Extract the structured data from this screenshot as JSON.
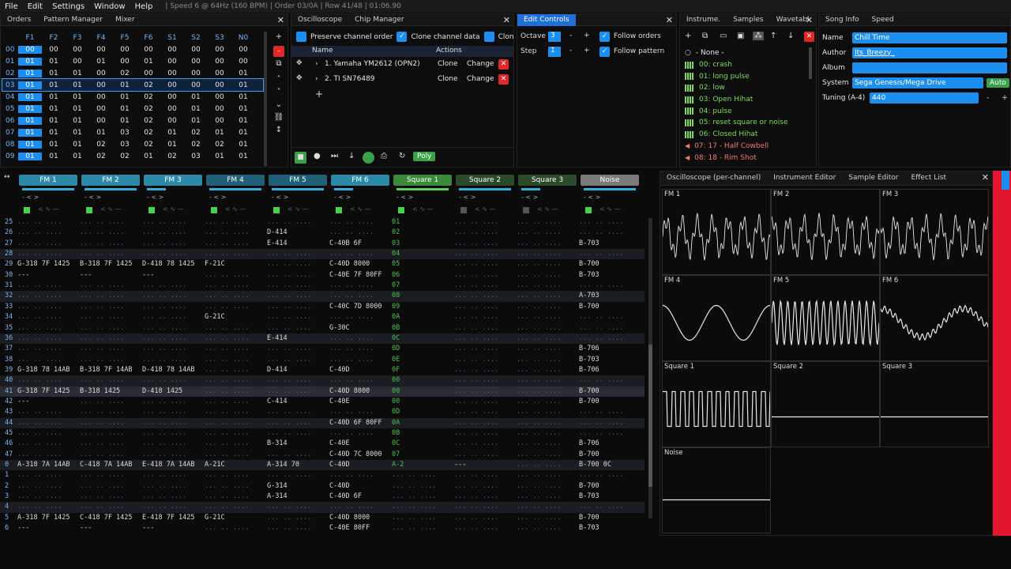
{
  "menubar": {
    "items": [
      "File",
      "Edit",
      "Settings",
      "Window",
      "Help"
    ],
    "status": "| Speed 6 @ 64Hz (160 BPM) | Order 03/0A | Row 41/48 | 01:06.90"
  },
  "orders": {
    "tabs": [
      "Orders",
      "Pattern Manager",
      "Mixer"
    ],
    "columns": [
      "F1",
      "F2",
      "F3",
      "F4",
      "F5",
      "F6",
      "S1",
      "S2",
      "S3",
      "N0"
    ],
    "rows": [
      {
        "idx": "00",
        "vals": [
          "00",
          "00",
          "00",
          "00",
          "00",
          "00",
          "00",
          "00",
          "00",
          "00"
        ]
      },
      {
        "idx": "01",
        "vals": [
          "01",
          "01",
          "00",
          "01",
          "00",
          "01",
          "00",
          "00",
          "00",
          "00"
        ]
      },
      {
        "idx": "02",
        "vals": [
          "01",
          "01",
          "01",
          "00",
          "02",
          "00",
          "00",
          "00",
          "00",
          "01"
        ]
      },
      {
        "idx": "03",
        "vals": [
          "01",
          "01",
          "01",
          "00",
          "01",
          "02",
          "00",
          "00",
          "00",
          "01"
        ]
      },
      {
        "idx": "04",
        "vals": [
          "01",
          "01",
          "01",
          "00",
          "01",
          "02",
          "00",
          "01",
          "00",
          "01"
        ]
      },
      {
        "idx": "05",
        "vals": [
          "01",
          "01",
          "01",
          "00",
          "01",
          "02",
          "00",
          "01",
          "00",
          "01"
        ]
      },
      {
        "idx": "06",
        "vals": [
          "01",
          "01",
          "01",
          "00",
          "01",
          "02",
          "00",
          "01",
          "00",
          "01"
        ]
      },
      {
        "idx": "07",
        "vals": [
          "01",
          "01",
          "01",
          "01",
          "03",
          "02",
          "01",
          "02",
          "01",
          "01"
        ]
      },
      {
        "idx": "08",
        "vals": [
          "01",
          "01",
          "01",
          "02",
          "03",
          "02",
          "01",
          "02",
          "02",
          "01"
        ]
      },
      {
        "idx": "09",
        "vals": [
          "01",
          "01",
          "01",
          "02",
          "02",
          "01",
          "02",
          "03",
          "01",
          "01"
        ]
      }
    ]
  },
  "chip": {
    "tabs": [
      "Oscilloscope",
      "Chip Manager"
    ],
    "options": [
      "Preserve channel order",
      "Clone channel data",
      "Clone"
    ],
    "col_name": "Name",
    "col_actions": "Actions",
    "chips": [
      "1. Yamaha YM2612 (OPN2)",
      "2. TI SN76489"
    ],
    "clone": "Clone",
    "change": "Change",
    "poly": "Poly"
  },
  "edit": {
    "tab": "Edit Controls",
    "octave_label": "Octave",
    "octave_value": "3",
    "step_label": "Step",
    "step_value": "1",
    "follow_orders": "Follow orders",
    "follow_pattern": "Follow pattern"
  },
  "instruments": {
    "tabs": [
      "Instrume.",
      "Samples",
      "Wavetabl."
    ],
    "items": [
      {
        "label": "- None -",
        "color": "#e6e6e6"
      },
      {
        "label": "00: crash",
        "color": "#7cdc5a"
      },
      {
        "label": "01: long pulse",
        "color": "#7cdc5a"
      },
      {
        "label": "02: low",
        "color": "#7cdc5a"
      },
      {
        "label": "03: Open Hihat",
        "color": "#7cdc5a"
      },
      {
        "label": "04: pulse",
        "color": "#7cdc5a"
      },
      {
        "label": "05: reset square or noise",
        "color": "#7cdc5a"
      },
      {
        "label": "06: Closed Hihat",
        "color": "#7cdc5a"
      },
      {
        "label": "07: 17 - Half Cowbell",
        "color": "#f07a7a"
      },
      {
        "label": "08: 18 - Rim Shot",
        "color": "#f07a7a"
      }
    ]
  },
  "song": {
    "tabs": [
      "Song Info",
      "Speed"
    ],
    "name_label": "Name",
    "name": "Chill Time",
    "author_label": "Author",
    "author": "Its_Breezy_",
    "album_label": "Album",
    "album": "",
    "system_label": "System",
    "system": "Sega Genesis/Mega Drive",
    "auto": "Auto",
    "tuning_label": "Tuning (A-4)",
    "tuning": "440"
  },
  "pattern": {
    "channels": [
      {
        "name": "FM 1",
        "color": "#2a8aa8"
      },
      {
        "name": "FM 2",
        "color": "#2a8aa8"
      },
      {
        "name": "FM 3",
        "color": "#2a8aa8"
      },
      {
        "name": "FM 4",
        "color": "#1f5f7a"
      },
      {
        "name": "FM 5",
        "color": "#1f5f7a"
      },
      {
        "name": "FM 6",
        "color": "#2a8aa8"
      },
      {
        "name": "Square 1",
        "color": "#3a8a3a"
      },
      {
        "name": "Square 2",
        "color": "#2a4a2a"
      },
      {
        "name": "Square 3",
        "color": "#2a4a2a"
      },
      {
        "name": "Noise",
        "color": "#7a7a7a"
      }
    ],
    "rows": [
      {
        "n": "25",
        "c": [
          "",
          "",
          "",
          "",
          "",
          "",
          "01",
          "",
          "",
          ""
        ]
      },
      {
        "n": "26",
        "c": [
          "",
          "",
          "",
          "",
          "D-414",
          "",
          "02",
          "",
          "",
          ""
        ]
      },
      {
        "n": "27",
        "c": [
          "",
          "",
          "",
          "",
          "E-414",
          "C-40B 6F",
          "03",
          "",
          "",
          "B-703"
        ]
      },
      {
        "n": "28",
        "c": [
          "",
          "",
          "",
          "",
          "",
          "",
          "04",
          "",
          "",
          ""
        ]
      },
      {
        "n": "29",
        "c": [
          "G-318 7F 1425",
          "B-318 7F 1425",
          "D-418 78 1425",
          "F-21C",
          "",
          "C-40D 8000",
          "05",
          "",
          "",
          "B-700"
        ]
      },
      {
        "n": "30",
        "c": [
          "---",
          "---",
          "---",
          "",
          "",
          "C-40E 7F 80FF",
          "06",
          "",
          "",
          "B-703"
        ]
      },
      {
        "n": "31",
        "c": [
          "",
          "",
          "",
          "",
          "",
          "",
          "07",
          "",
          "",
          ""
        ]
      },
      {
        "n": "32",
        "c": [
          "",
          "",
          "",
          "",
          "",
          "",
          "08",
          "",
          "",
          "A-703"
        ]
      },
      {
        "n": "33",
        "c": [
          "",
          "",
          "",
          "",
          "",
          "C-40C 7D 8000",
          "09",
          "",
          "",
          "B-700"
        ]
      },
      {
        "n": "34",
        "c": [
          "",
          "",
          "",
          "G-21C",
          "",
          "",
          "0A",
          "",
          "",
          ""
        ]
      },
      {
        "n": "35",
        "c": [
          "",
          "",
          "",
          "",
          "",
          "G-30C",
          "0B",
          "",
          "",
          ""
        ]
      },
      {
        "n": "36",
        "c": [
          "",
          "",
          "",
          "",
          "E-414",
          "",
          "0C",
          "",
          "",
          ""
        ]
      },
      {
        "n": "37",
        "c": [
          "",
          "",
          "",
          "",
          "",
          "",
          "0D",
          "",
          "",
          "B-706"
        ]
      },
      {
        "n": "38",
        "c": [
          "",
          "",
          "",
          "",
          "",
          "",
          "0E",
          "",
          "",
          "B-703"
        ]
      },
      {
        "n": "39",
        "c": [
          "G-318 78 14AB",
          "B-318 7F 14AB",
          "D-418 78 14AB",
          "",
          "D-414",
          "C-40D",
          "0F",
          "",
          "",
          "B-706"
        ]
      },
      {
        "n": "40",
        "c": [
          "",
          "",
          "",
          "",
          "",
          "",
          "00",
          "",
          "",
          ""
        ]
      },
      {
        "n": "41",
        "c": [
          "G-318 7F 1425",
          "B-318 1425",
          "D-418 1425",
          "",
          "",
          "C-40D 8000",
          "00",
          "",
          "",
          "B-700"
        ]
      },
      {
        "n": "42",
        "c": [
          "---",
          "",
          "",
          "",
          "C-414",
          "C-40E",
          "00",
          "",
          "",
          "B-700"
        ]
      },
      {
        "n": "43",
        "c": [
          "",
          "",
          "",
          "",
          "",
          "",
          "0D",
          "",
          "",
          ""
        ]
      },
      {
        "n": "44",
        "c": [
          "",
          "",
          "",
          "",
          "",
          "C-40D 6F 80FF",
          "0A",
          "",
          "",
          ""
        ]
      },
      {
        "n": "45",
        "c": [
          "",
          "",
          "",
          "",
          "",
          "",
          "0B",
          "",
          "",
          ""
        ]
      },
      {
        "n": "46",
        "c": [
          "",
          "",
          "",
          "",
          "B-314",
          "C-40E",
          "0C",
          "",
          "",
          "B-706"
        ]
      },
      {
        "n": "47",
        "c": [
          "",
          "",
          "",
          "",
          "",
          "C-40D 7C 8000",
          "07",
          "",
          "",
          "B-700"
        ]
      },
      {
        "n": "0",
        "c": [
          "A-318 7A 14AB",
          "C-418 7A 14AB",
          "E-418 7A 14AB",
          "A-21C",
          "A-314 70",
          "C-40D",
          "A-2",
          "---",
          "",
          "B-700 0C"
        ]
      },
      {
        "n": "1",
        "c": [
          "",
          "",
          "",
          "",
          "",
          "",
          "",
          "",
          "",
          ""
        ]
      },
      {
        "n": "2",
        "c": [
          "",
          "",
          "",
          "",
          "G-314",
          "C-40D",
          "",
          "",
          "",
          "B-700"
        ]
      },
      {
        "n": "3",
        "c": [
          "",
          "",
          "",
          "",
          "A-314",
          "C-40D 6F",
          "",
          "",
          "",
          "B-703"
        ]
      },
      {
        "n": "4",
        "c": [
          "",
          "",
          "",
          "",
          "",
          "",
          "",
          "",
          "",
          ""
        ]
      },
      {
        "n": "5",
        "c": [
          "A-318 7F 1425",
          "C-418 7F 1425",
          "E-418 7F 1425",
          "G-21C",
          "",
          "C-40D 8000",
          "",
          "",
          "",
          "B-700"
        ]
      },
      {
        "n": "6",
        "c": [
          "---",
          "---",
          "---",
          "",
          "",
          "C-40E 80FF",
          "",
          "",
          "",
          "B-703"
        ]
      }
    ]
  },
  "scope": {
    "tabs": [
      "Oscilloscope (per-channel)",
      "Instrument Editor",
      "Sample Editor",
      "Effect List"
    ],
    "labels": [
      "FM 1",
      "FM 2",
      "FM 3",
      "FM 4",
      "FM 5",
      "FM 6",
      "Square 1",
      "Square 2",
      "Square 3",
      "Noise"
    ]
  },
  "colors": {
    "accent": "#1c8ef0",
    "danger": "#e02828",
    "redbar": "#e2172e"
  }
}
